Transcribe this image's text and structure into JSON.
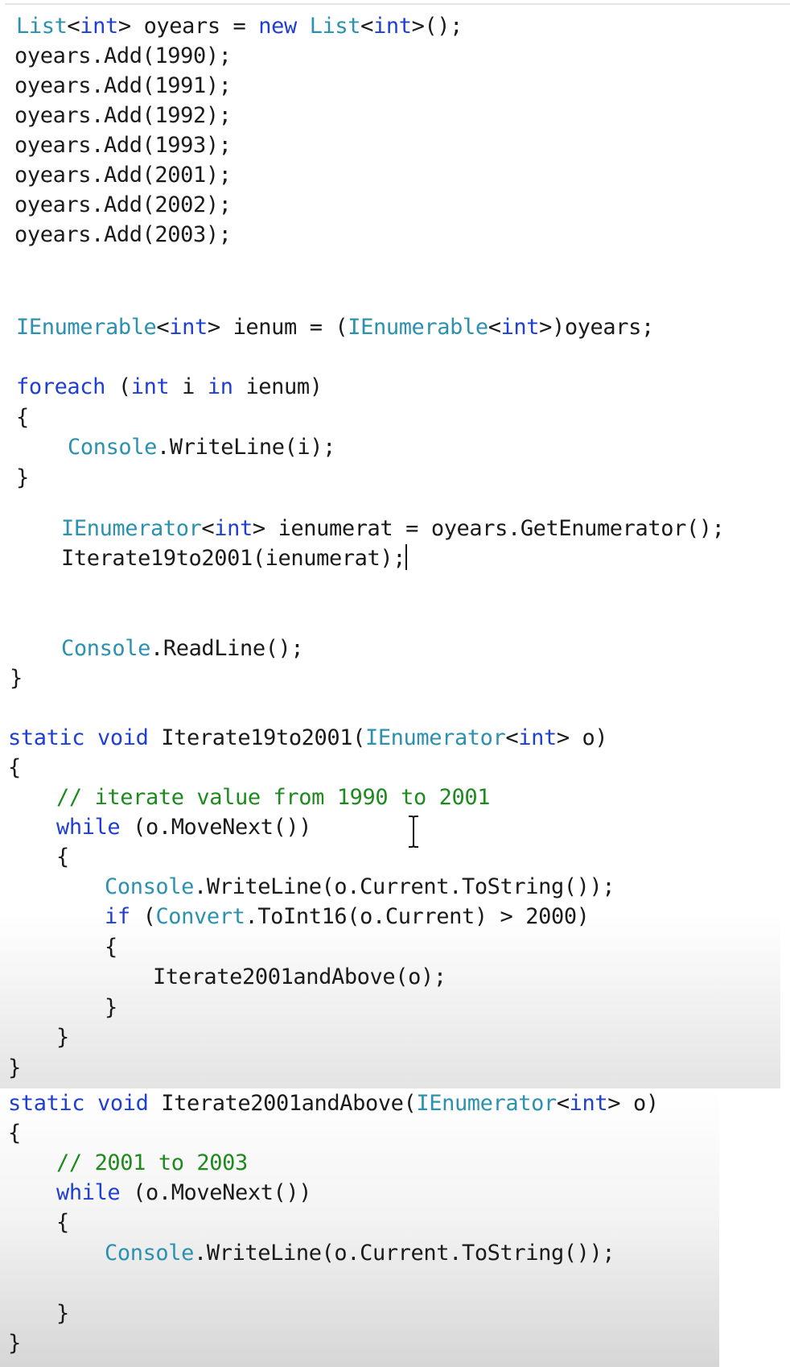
{
  "colors": {
    "keyword": "#1f3fd0",
    "type": "#2b91af",
    "comment": "#1e8a1e",
    "text": "#1a1a1a",
    "background": "#ffffff"
  },
  "cursor_icon": "text-ibeam-icon",
  "code_block_1": {
    "lines": [
      [
        {
          "t": "ty",
          "v": "List"
        },
        {
          "t": "tx",
          "v": "<"
        },
        {
          "t": "kw",
          "v": "int"
        },
        {
          "t": "tx",
          "v": "> oyears = "
        },
        {
          "t": "kw",
          "v": "new"
        },
        {
          "t": "tx",
          "v": " "
        },
        {
          "t": "ty",
          "v": "List"
        },
        {
          "t": "tx",
          "v": "<"
        },
        {
          "t": "kw",
          "v": "int"
        },
        {
          "t": "tx",
          "v": ">();"
        }
      ],
      [
        {
          "t": "tx",
          "v": "oyears.Add(1990);"
        }
      ],
      [
        {
          "t": "tx",
          "v": "oyears.Add(1991);"
        }
      ],
      [
        {
          "t": "tx",
          "v": "oyears.Add(1992);"
        }
      ],
      [
        {
          "t": "tx",
          "v": "oyears.Add(1993);"
        }
      ],
      [
        {
          "t": "tx",
          "v": "oyears.Add(2001);"
        }
      ],
      [
        {
          "t": "tx",
          "v": "oyears.Add(2002);"
        }
      ],
      [
        {
          "t": "tx",
          "v": "oyears.Add(2003);"
        }
      ],
      [
        {
          "t": "ty",
          "v": "IEnumerable"
        },
        {
          "t": "tx",
          "v": "<"
        },
        {
          "t": "kw",
          "v": "int"
        },
        {
          "t": "tx",
          "v": "> ienum = ("
        },
        {
          "t": "ty",
          "v": "IEnumerable"
        },
        {
          "t": "tx",
          "v": "<"
        },
        {
          "t": "kw",
          "v": "int"
        },
        {
          "t": "tx",
          "v": ">)oyears;"
        }
      ],
      [
        {
          "t": "kw",
          "v": "foreach"
        },
        {
          "t": "tx",
          "v": " ("
        },
        {
          "t": "kw",
          "v": "int"
        },
        {
          "t": "tx",
          "v": " i "
        },
        {
          "t": "kw",
          "v": "in"
        },
        {
          "t": "tx",
          "v": " ienum)"
        }
      ],
      [
        {
          "t": "tx",
          "v": "{"
        }
      ],
      [
        {
          "t": "ty",
          "v": "Console"
        },
        {
          "t": "tx",
          "v": ".WriteLine(i);"
        }
      ],
      [
        {
          "t": "tx",
          "v": "}"
        }
      ],
      [
        {
          "t": "ty",
          "v": "IEnumerator"
        },
        {
          "t": "tx",
          "v": "<"
        },
        {
          "t": "kw",
          "v": "int"
        },
        {
          "t": "tx",
          "v": "> ienumerat = oyears.GetEnumerator();"
        }
      ],
      [
        {
          "t": "tx",
          "v": "Iterate19to2001(ienumerat);"
        },
        {
          "t": "caret",
          "v": ""
        }
      ],
      [
        {
          "t": "ty",
          "v": "Console"
        },
        {
          "t": "tx",
          "v": ".ReadLine();"
        }
      ],
      [
        {
          "t": "tx",
          "v": "}"
        }
      ]
    ]
  },
  "code_block_2": {
    "lines": [
      [
        {
          "t": "kw",
          "v": "static"
        },
        {
          "t": "tx",
          "v": " "
        },
        {
          "t": "kw",
          "v": "void"
        },
        {
          "t": "tx",
          "v": " Iterate19to2001("
        },
        {
          "t": "ty",
          "v": "IEnumerator"
        },
        {
          "t": "tx",
          "v": "<"
        },
        {
          "t": "kw",
          "v": "int"
        },
        {
          "t": "tx",
          "v": "> o)"
        }
      ],
      [
        {
          "t": "tx",
          "v": "{"
        }
      ],
      [
        {
          "t": "cm",
          "v": "// iterate value from 1990 to 2001"
        }
      ],
      [
        {
          "t": "kw",
          "v": "while"
        },
        {
          "t": "tx",
          "v": " (o.MoveNext())"
        }
      ],
      [
        {
          "t": "tx",
          "v": "{"
        }
      ],
      [
        {
          "t": "ty",
          "v": "Console"
        },
        {
          "t": "tx",
          "v": ".WriteLine(o.Current.ToString());"
        }
      ],
      [
        {
          "t": "kw",
          "v": "if"
        },
        {
          "t": "tx",
          "v": " ("
        },
        {
          "t": "ty",
          "v": "Convert"
        },
        {
          "t": "tx",
          "v": ".ToInt16(o.Current) > 2000)"
        }
      ],
      [
        {
          "t": "tx",
          "v": "{"
        }
      ],
      [
        {
          "t": "tx",
          "v": "Iterate2001andAbove(o);"
        }
      ],
      [
        {
          "t": "tx",
          "v": "}"
        }
      ],
      [
        {
          "t": "tx",
          "v": "}"
        }
      ],
      [
        {
          "t": "tx",
          "v": "}"
        }
      ]
    ]
  },
  "code_block_3": {
    "lines": [
      [
        {
          "t": "kw",
          "v": "static"
        },
        {
          "t": "tx",
          "v": " "
        },
        {
          "t": "kw",
          "v": "void"
        },
        {
          "t": "tx",
          "v": " Iterate2001andAbove("
        },
        {
          "t": "ty",
          "v": "IEnumerator"
        },
        {
          "t": "tx",
          "v": "<"
        },
        {
          "t": "kw",
          "v": "int"
        },
        {
          "t": "tx",
          "v": "> o)"
        }
      ],
      [
        {
          "t": "tx",
          "v": "{"
        }
      ],
      [
        {
          "t": "cm",
          "v": "// 2001 to 2003"
        }
      ],
      [
        {
          "t": "kw",
          "v": "while"
        },
        {
          "t": "tx",
          "v": " (o.MoveNext())"
        }
      ],
      [
        {
          "t": "tx",
          "v": "{"
        }
      ],
      [
        {
          "t": "ty",
          "v": "Console"
        },
        {
          "t": "tx",
          "v": ".WriteLine(o.Current.ToString());"
        }
      ],
      [
        {
          "t": "tx",
          "v": "}"
        }
      ],
      [
        {
          "t": "tx",
          "v": "}"
        }
      ]
    ]
  }
}
